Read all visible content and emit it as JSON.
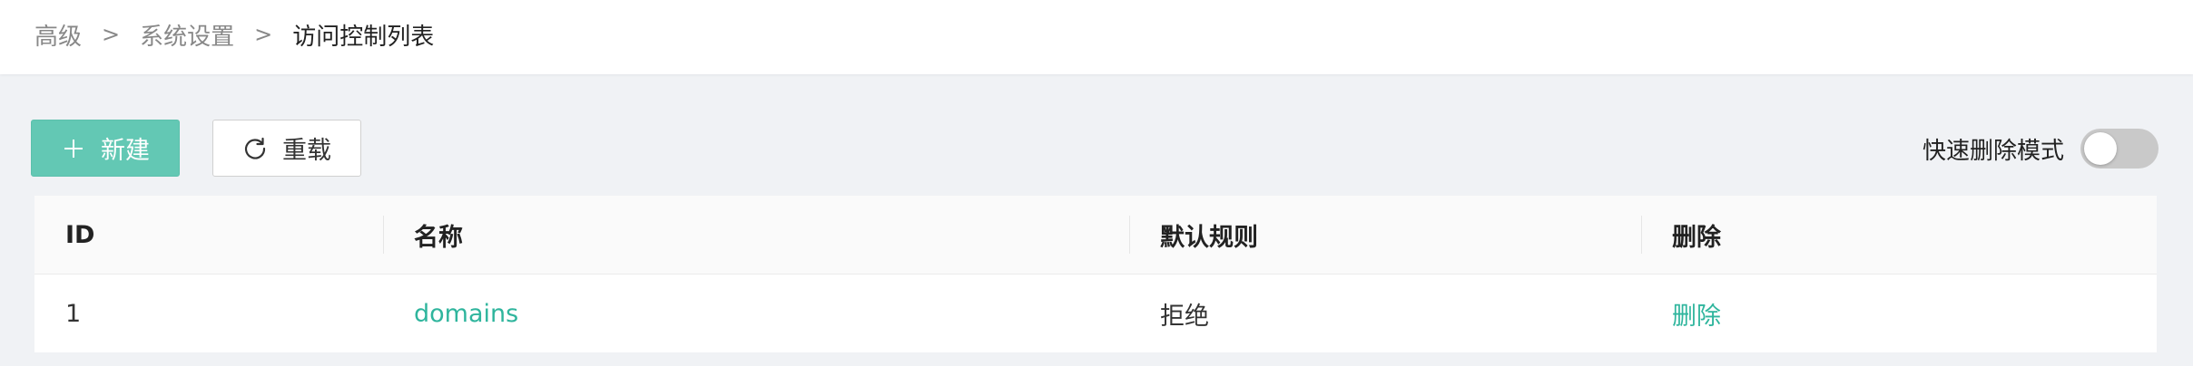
{
  "breadcrumb": {
    "items": [
      "高级",
      "系统设置",
      "访问控制列表"
    ],
    "separator": ">"
  },
  "toolbar": {
    "new_label": "新建",
    "reload_label": "重载",
    "quick_delete_label": "快速删除模式",
    "quick_delete_enabled": false
  },
  "table": {
    "headers": [
      "ID",
      "名称",
      "默认规则",
      "删除"
    ],
    "rows": [
      {
        "id": "1",
        "name": "domains",
        "default_rule": "拒绝",
        "delete": "删除"
      }
    ]
  },
  "colors": {
    "accent": "#63c8b4",
    "link": "#2fb59d",
    "background": "#f0f2f5"
  },
  "icons": {
    "new": "plus-icon",
    "reload": "reload-icon"
  }
}
